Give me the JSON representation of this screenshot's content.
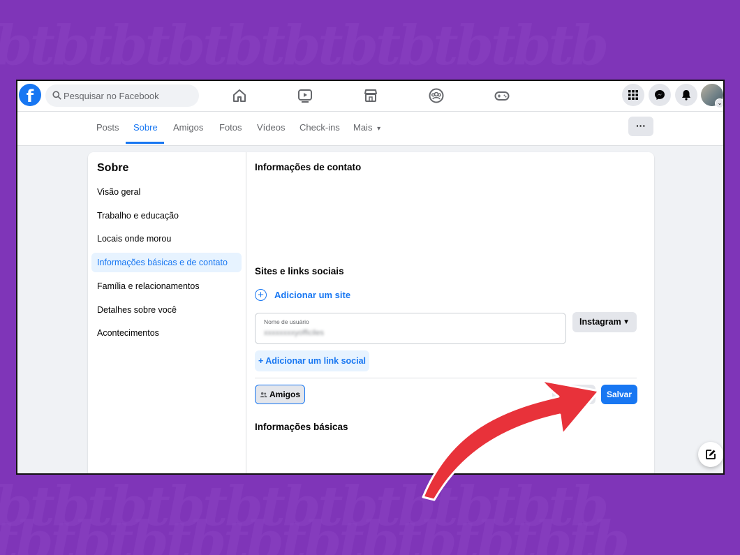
{
  "watermark": {
    "text": "tbtbtbtbtbtbtbtbtbtbtb"
  },
  "topbar": {
    "logo_glyph": "f",
    "search_placeholder": "Pesquisar no Facebook",
    "nav_icons": [
      "home-icon",
      "video-icon",
      "marketplace-icon",
      "groups-icon",
      "gaming-icon"
    ],
    "right_icons": [
      "menu-grid-icon",
      "messenger-icon",
      "notifications-icon"
    ],
    "avatar_caret": "⌄"
  },
  "tabs": {
    "items": [
      "Posts",
      "Sobre",
      "Amigos",
      "Fotos",
      "Vídeos",
      "Check-ins",
      "Mais"
    ],
    "active": "Sobre",
    "more_caret": "▾",
    "more_button": "···"
  },
  "sidebar": {
    "title": "Sobre",
    "items": [
      "Visão geral",
      "Trabalho e educação",
      "Locais onde morou",
      "Informações básicas e de contato",
      "Família e relacionamentos",
      "Detalhes sobre você",
      "Acontecimentos"
    ],
    "active_index": 3
  },
  "main": {
    "contact_heading": "Informações de contato",
    "sites_heading": "Sites e links sociais",
    "add_site_label": "Adicionar um site",
    "add_site_icon": "+",
    "username_label": "Nome de usuário",
    "username_value": "xxxxxxxxyofficiles",
    "network_select": "Instagram",
    "network_caret": "▼",
    "add_social_link": "+ Adicionar um link social",
    "privacy_button": "Amigos",
    "privacy_icon": "friends-icon",
    "save_button": "Salvar",
    "basic_info_heading": "Informações básicas"
  },
  "colors": {
    "background": "#7f35b8",
    "facebook_blue": "#1877f2",
    "arrow_red": "#e8323a"
  }
}
